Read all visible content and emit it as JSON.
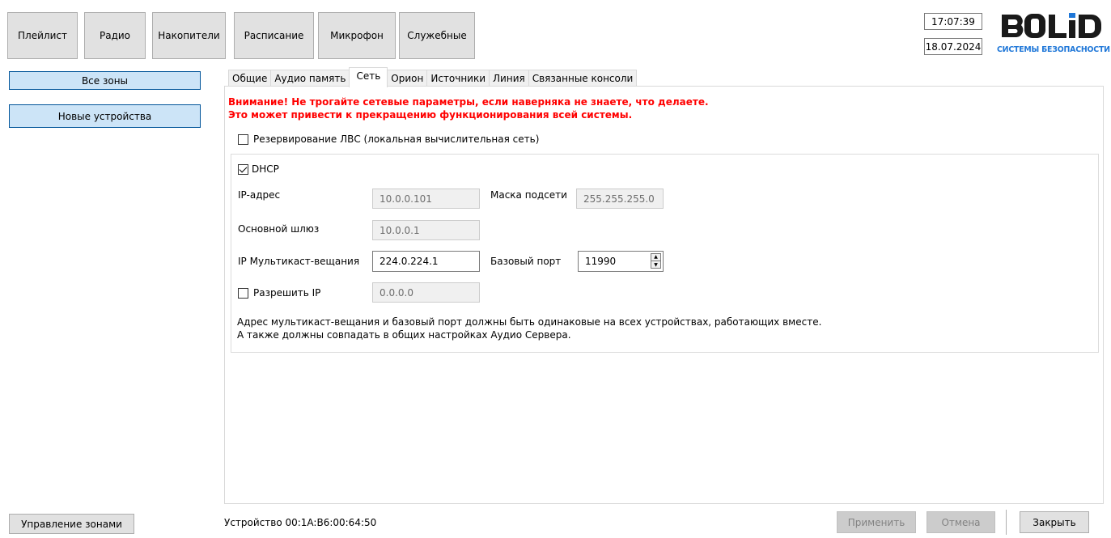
{
  "nav": {
    "items": [
      {
        "label": "Плейлист"
      },
      {
        "label": "Радио"
      },
      {
        "label": "Накопители"
      },
      {
        "label": "Расписание"
      },
      {
        "label": "Микрофон"
      },
      {
        "label": "Служебные"
      }
    ]
  },
  "clock": {
    "time": "17:07:39",
    "date": "18.07.2024"
  },
  "logo": {
    "word": "BOLID",
    "subtitle": "СИСТЕМЫ БЕЗОПАСНОСТИ",
    "colors": {
      "dark": "#1a1a1a",
      "blue": "#1f77d8"
    }
  },
  "sidebar": {
    "all_zones": "Все зоны",
    "new_devices": "Новые устройства",
    "manage_zones": "Управление зонами"
  },
  "tabs": [
    {
      "label": "Общие",
      "active": false
    },
    {
      "label": "Аудио память",
      "active": false
    },
    {
      "label": "Сеть",
      "active": true
    },
    {
      "label": "Орион",
      "active": false
    },
    {
      "label": "Источники",
      "active": false
    },
    {
      "label": "Линия",
      "active": false
    },
    {
      "label": "Связанные консоли",
      "active": false
    }
  ],
  "network": {
    "warning_line1": "Внимание! Не трогайте сетевые параметры, если наверняка не знаете, что делаете.",
    "warning_line2": "Это может привести к прекращению функционирования всей системы.",
    "lan_redundancy": {
      "label": "Резервирование ЛВС (локальная вычислительная сеть)",
      "checked": false
    },
    "dhcp": {
      "label": "DHCP",
      "checked": true
    },
    "ip_address": {
      "label": "IP-адрес",
      "value": "10.0.0.101"
    },
    "subnet_mask": {
      "label": "Маска подсети",
      "value": "255.255.255.0"
    },
    "gateway": {
      "label": "Основной шлюз",
      "value": "10.0.0.1"
    },
    "multicast_ip": {
      "label": "IP Мультикаст-вещания",
      "value": "224.0.224.1"
    },
    "base_port": {
      "label": "Базовый порт",
      "value": "11990"
    },
    "allow_ip": {
      "label": "Разрешить IP",
      "checked": false,
      "value": "0.0.0.0"
    },
    "note_line1": "Адрес мультикаст-вещания и базовый порт должны быть одинаковые на всех устройствах, работающих вместе.",
    "note_line2": "А также должны совпадать в общих настройках Аудио Сервера."
  },
  "footer": {
    "device_label": "Устройство 00:1A:B6:00:64:50",
    "apply": "Применить",
    "cancel": "Отмена",
    "close": "Закрыть"
  },
  "colors": {
    "warning": "#ff0000",
    "selected_button": "#cce4f7",
    "selected_border": "#005499"
  }
}
